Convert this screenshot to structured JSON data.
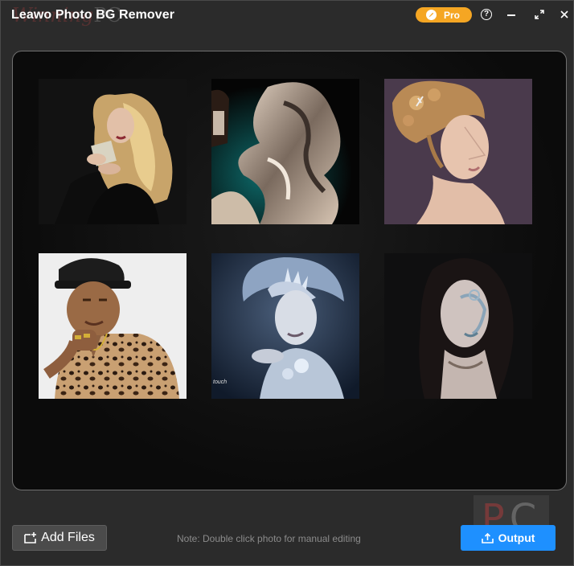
{
  "app": {
    "title": "Leawo Photo BG Remover",
    "watermark_left": "Winning",
    "watermark_right": "PC"
  },
  "titlebar": {
    "pro_label": "Pro",
    "pro_color": "#f5a623",
    "icons": [
      "rocket-icon",
      "help-icon",
      "minimize-icon",
      "maximize-icon",
      "close-icon"
    ]
  },
  "gallery": {
    "photos": [
      {
        "name": "blonde-woman-with-perfume"
      },
      {
        "name": "woman-in-silver-fabric"
      },
      {
        "name": "woman-with-updo"
      },
      {
        "name": "man-in-leopard-shirt"
      },
      {
        "name": "ice-queen-portrait",
        "caption": "touch"
      },
      {
        "name": "woman-with-face-paint"
      }
    ]
  },
  "footer": {
    "add_files_label": "Add Files",
    "note": "Note: Double click photo for manual editing",
    "output_label": "Output",
    "output_color": "#1e90ff",
    "watermark": {
      "p": "P",
      "c": "C"
    }
  }
}
